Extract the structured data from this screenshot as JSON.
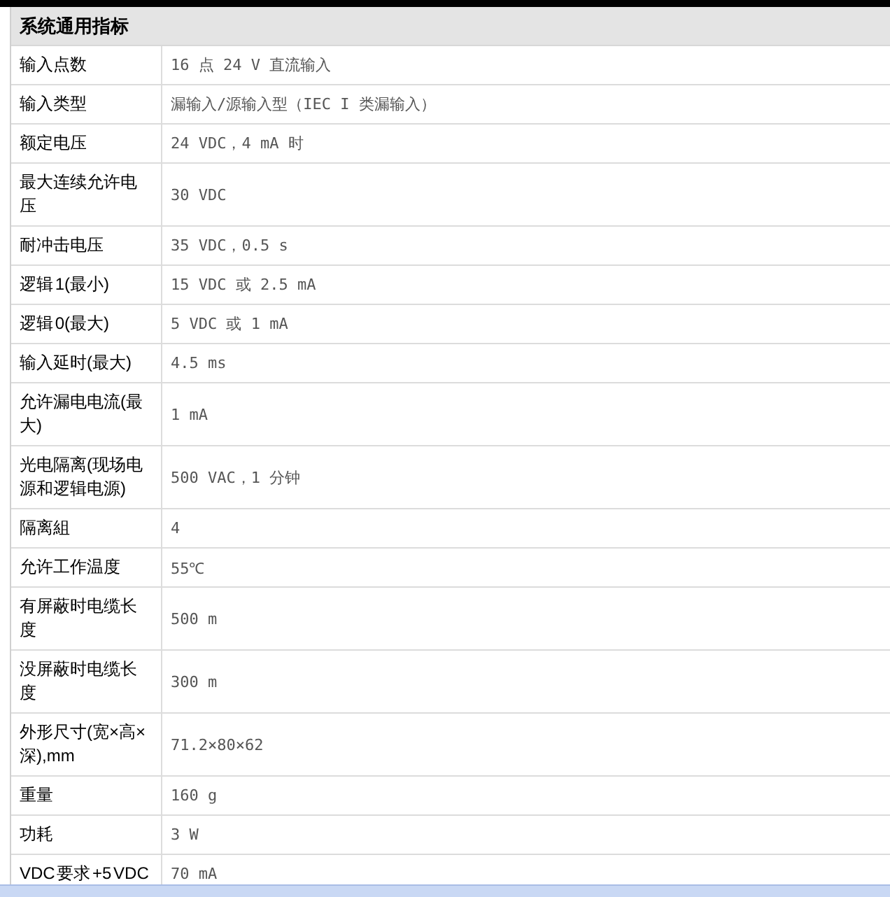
{
  "table": {
    "title": "系统通用指标",
    "rows": [
      {
        "label": "输入点数",
        "value": "16 点 24 V 直流输入"
      },
      {
        "label": "输入类型",
        "value": "漏输入/源输入型（IEC I 类漏输入）"
      },
      {
        "label": "额定电压",
        "value": "24 VDC，4 mA 时"
      },
      {
        "label": "最大连续允许电压",
        "value": "30 VDC"
      },
      {
        "label": "耐冲击电压",
        "value": "35 VDC，0.5 s"
      },
      {
        "label": "逻辑 1(最小)",
        "value": "15 VDC 或 2.5 mA"
      },
      {
        "label": "逻辑 0(最大)",
        "value": "5 VDC 或 1 mA"
      },
      {
        "label": "输入延时(最大)",
        "value": "4.5 ms"
      },
      {
        "label": "允许漏电电流(最大)",
        "value": "1 mA"
      },
      {
        "label": "光电隔离(现场电源和逻辑电源)",
        "value": "500 VAC，1 分钟"
      },
      {
        "label": "隔离組",
        "value": "4"
      },
      {
        "label": "允许工作温度",
        "value": "55℃"
      },
      {
        "label": "有屏蔽时电缆长度",
        "value": "500 m"
      },
      {
        "label": "没屏蔽时电缆长度",
        "value": "300 m"
      },
      {
        "label": "外形尺寸(宽×高×深),mm",
        "value": "71.2×80×62"
      },
      {
        "label": "重量",
        "value": "160 g"
      },
      {
        "label": "功耗",
        "value": "3 W"
      },
      {
        "label": "VDC 要求 +5 VDC",
        "value": "70 mA"
      }
    ]
  }
}
